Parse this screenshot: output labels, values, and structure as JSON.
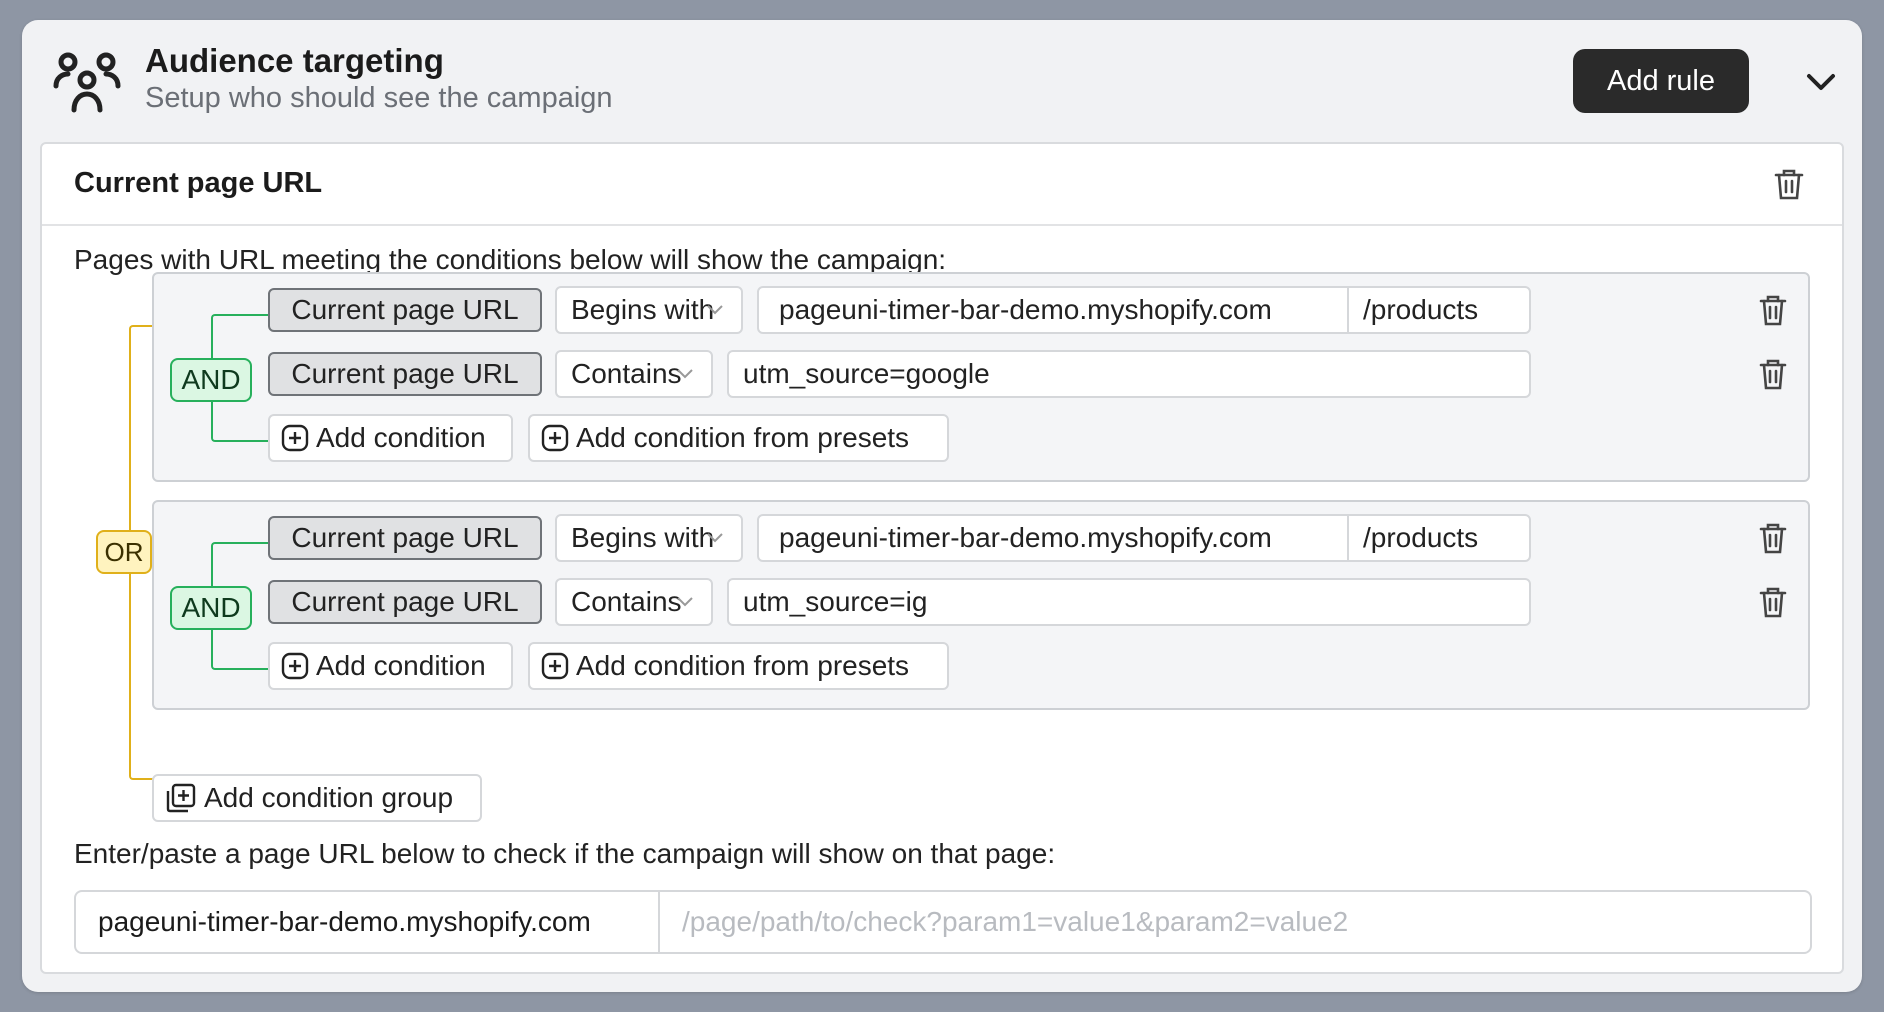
{
  "header": {
    "title": "Audience targeting",
    "subtitle": "Setup who should see the campaign",
    "add_rule_label": "Add rule"
  },
  "rule": {
    "title": "Current page URL",
    "description": "Pages with URL meeting the conditions below will show the campaign:",
    "or_label": "OR",
    "groups": [
      {
        "and_label": "AND",
        "conditions": [
          {
            "field": "Current page URL",
            "operator": "Begins with",
            "domain": "pageuni-timer-bar-demo.myshopify.com",
            "value": "/products"
          },
          {
            "field": "Current page URL",
            "operator": "Contains",
            "value": "utm_source=google"
          }
        ],
        "add_condition_label": "Add condition",
        "add_preset_label": "Add condition from presets"
      },
      {
        "and_label": "AND",
        "conditions": [
          {
            "field": "Current page URL",
            "operator": "Begins with",
            "domain": "pageuni-timer-bar-demo.myshopify.com",
            "value": "/products"
          },
          {
            "field": "Current page URL",
            "operator": "Contains",
            "value": "utm_source=ig"
          }
        ],
        "add_condition_label": "Add condition",
        "add_preset_label": "Add condition from presets"
      }
    ],
    "add_group_label": "Add condition group",
    "check_label": "Enter/paste a page URL below to check if the campaign will show on that page:",
    "check_domain": "pageuni-timer-bar-demo.myshopify.com",
    "check_placeholder": "/page/path/to/check?param1=value1&param2=value2"
  },
  "colors": {
    "or_accent": "#e0b01a",
    "and_accent": "#27b05c",
    "primary_button": "#2a2a2a"
  },
  "icons": {
    "header": "audience-icon",
    "collapse": "chevron-down-icon",
    "delete": "trash-icon",
    "add": "plus-square-icon",
    "add_group": "stacked-plus-icon"
  }
}
